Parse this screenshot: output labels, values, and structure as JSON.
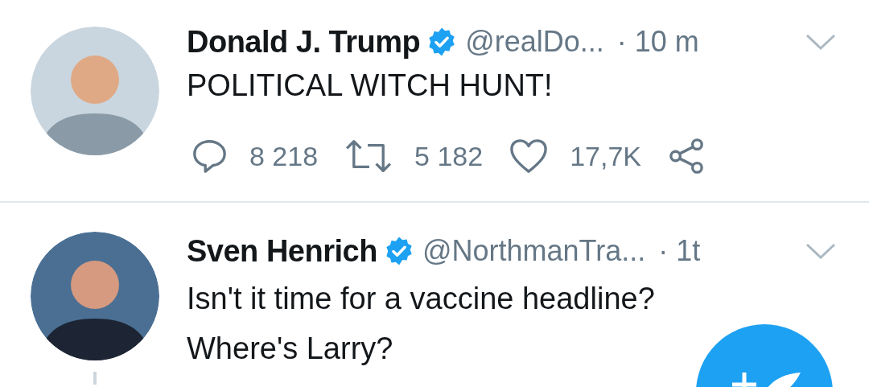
{
  "tweets": [
    {
      "name": "Donald J. Trump",
      "verified": true,
      "handle": "@realDo...",
      "time": "· 10 m",
      "text": "POLITICAL WITCH HUNT!",
      "threaded": false,
      "actions": {
        "replies": "8 218",
        "retweets": "5 182",
        "likes": "17,7K"
      }
    },
    {
      "name": "Sven Henrich",
      "verified": true,
      "handle": "@NorthmanTra...",
      "time": "· 1t",
      "text": "Isn't it time for a vaccine headline? Where's Larry?",
      "threaded": true
    }
  ],
  "compose_button": {
    "kind": "compose"
  }
}
